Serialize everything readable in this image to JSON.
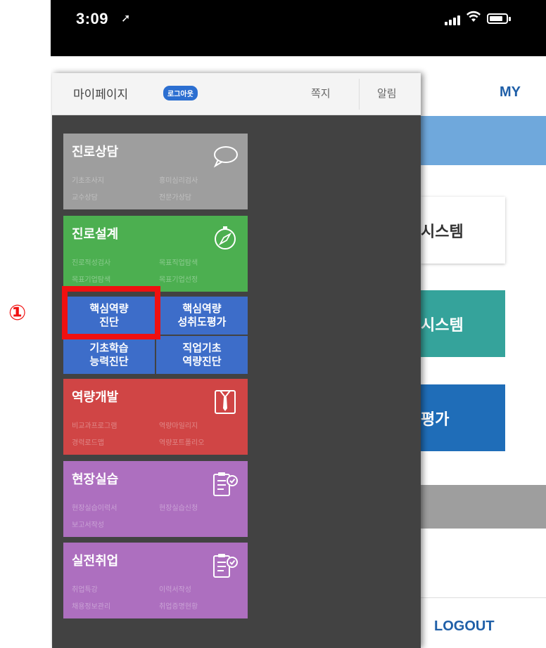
{
  "status_bar": {
    "time": "3:09"
  },
  "background": {
    "my_label": "MY",
    "cards": [
      "시스템",
      "시스템",
      "평가"
    ],
    "logout_label": "LOGOUT"
  },
  "drawer": {
    "title": "마이페이지",
    "logout_badge": "로그아웃",
    "note_label": "쪽지",
    "alarm_label": "알림",
    "tiles": [
      {
        "title": "진로상담",
        "icon": "speech-bubble-icon",
        "color": "#9e9e9e",
        "subs": [
          "기초조사지",
          "흥미심리검사",
          "교수상담",
          "전문가상담"
        ]
      },
      {
        "title": "진로설계",
        "icon": "compass-icon",
        "color": "#4caf50",
        "subs": [
          "진로적성검사",
          "목표직업탐색",
          "목표기업탐색",
          "목표기업선정"
        ]
      },
      {
        "title": "역량개발",
        "icon": "shirt-tie-icon",
        "color": "#d04545",
        "subs": [
          "비교과프로그램",
          "역량마일리지",
          "경력로드맵",
          "역량포트폴리오"
        ]
      },
      {
        "title": "현장실습",
        "icon": "clipboard-icon",
        "color": "#ad6fbf",
        "subs": [
          "현장실습이력서",
          "현장실습신청",
          "보고서작성"
        ]
      },
      {
        "title": "실전취업",
        "icon": "clipboard-icon",
        "color": "#ad6fbf",
        "subs": [
          "취업특강",
          "이력서작성",
          "채용정보관리",
          "취업증명현황"
        ]
      }
    ],
    "assessment_grid": [
      {
        "line1": "핵심역량",
        "line2": "진단"
      },
      {
        "line1": "핵심역량",
        "line2": "성취도평가"
      },
      {
        "line1": "기초학습",
        "line2": "능력진단"
      },
      {
        "line1": "직업기초",
        "line2": "역량진단"
      }
    ],
    "accent_color": "#3d6dc9"
  },
  "annotation": {
    "marker": "①",
    "color": "#f01010"
  }
}
